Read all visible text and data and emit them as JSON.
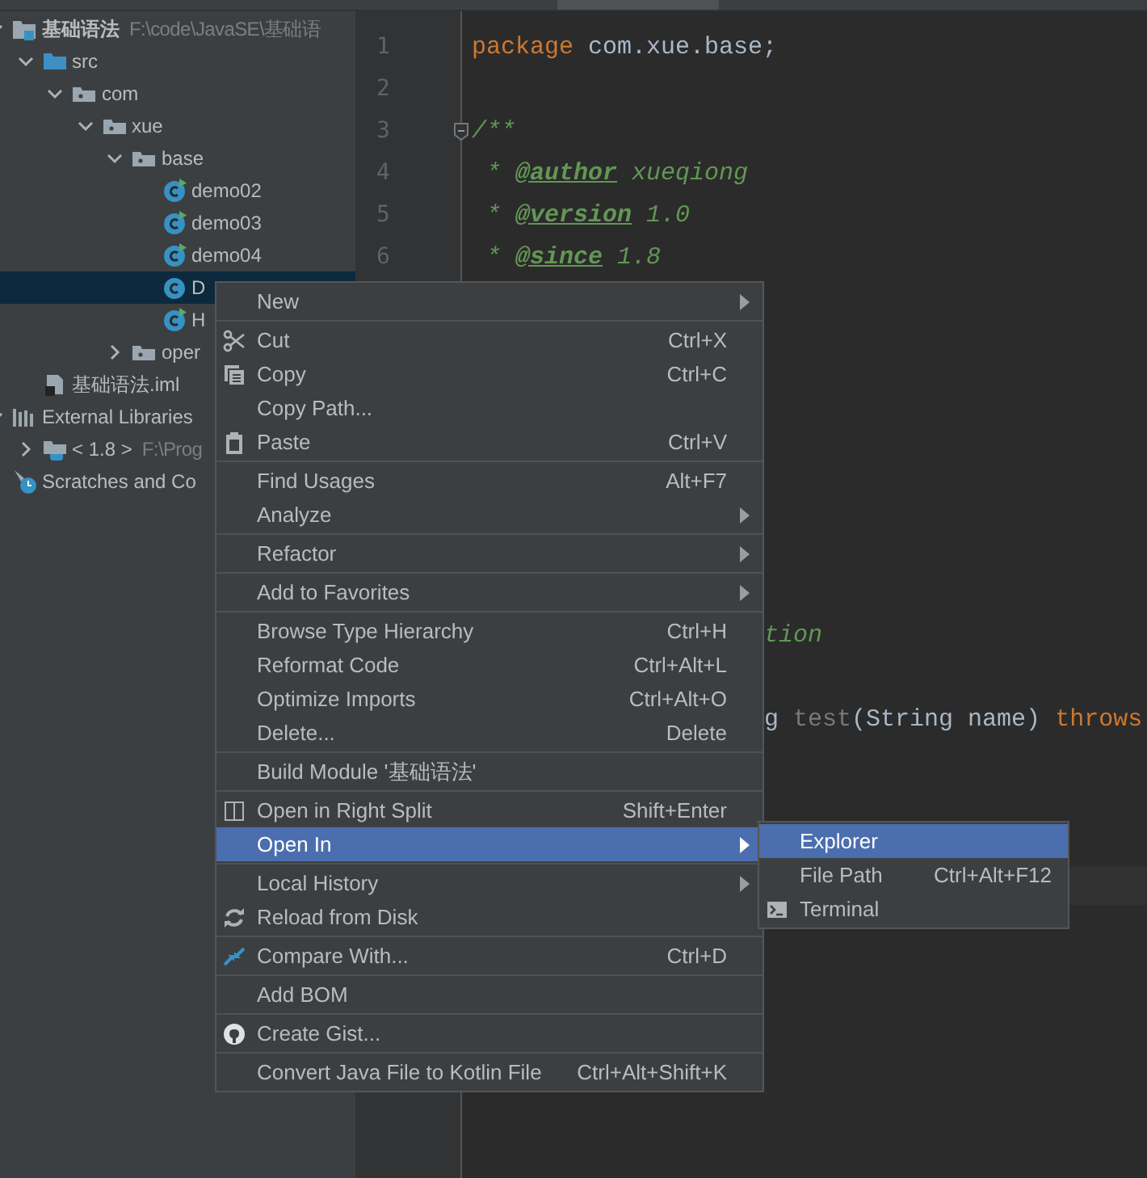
{
  "project_tree": [
    {
      "label": "基础语法",
      "path": "F:\\code\\JavaSE\\基础语",
      "kind": "module",
      "expanded": true,
      "selected": false,
      "children": [
        {
          "label": "src",
          "kind": "source-folder",
          "expanded": true,
          "selected": false,
          "children": [
            {
              "label": "com",
              "kind": "package",
              "expanded": true,
              "selected": false,
              "children": [
                {
                  "label": "xue",
                  "kind": "package",
                  "expanded": true,
                  "selected": false,
                  "children": [
                    {
                      "label": "base",
                      "kind": "package",
                      "expanded": true,
                      "selected": false,
                      "children": [
                        {
                          "label": "demo02",
                          "kind": "class",
                          "runnable": true,
                          "selected": false
                        },
                        {
                          "label": "demo03",
                          "kind": "class",
                          "runnable": true,
                          "selected": false
                        },
                        {
                          "label": "demo04",
                          "kind": "class",
                          "runnable": true,
                          "selected": false
                        },
                        {
                          "label": "D",
                          "kind": "class",
                          "runnable": false,
                          "selected": true
                        },
                        {
                          "label": "H",
                          "kind": "class",
                          "runnable": true,
                          "selected": false
                        }
                      ]
                    },
                    {
                      "label": "oper",
                      "kind": "package",
                      "expanded": false,
                      "selected": false
                    }
                  ]
                }
              ]
            }
          ]
        },
        {
          "label": "基础语法.iml",
          "kind": "file",
          "selected": false
        }
      ]
    },
    {
      "label": "External Libraries",
      "kind": "libraries",
      "expanded": true,
      "selected": false,
      "children": [
        {
          "label": "< 1.8 >",
          "path": "F:\\Prog",
          "kind": "sdk",
          "expanded": false,
          "selected": false
        }
      ]
    },
    {
      "label": "Scratches and Co",
      "kind": "scratches",
      "selected": false
    }
  ],
  "editor": {
    "lines": [
      {
        "number": "1",
        "segments": [
          {
            "text": "package ",
            "kind": "keyword"
          },
          {
            "text": "com.xue.base;",
            "kind": "plain"
          }
        ]
      },
      {
        "number": "2"
      },
      {
        "number": "3",
        "foldable": true,
        "segments": [
          {
            "text": "/**",
            "kind": "doc"
          }
        ]
      },
      {
        "number": "4",
        "segments": [
          {
            "text": " * ",
            "kind": "doc"
          },
          {
            "text": "@author",
            "kind": "doctag"
          },
          {
            "text": " xueqiong",
            "kind": "doc"
          }
        ]
      },
      {
        "number": "5",
        "segments": [
          {
            "text": " * ",
            "kind": "doc"
          },
          {
            "text": "@version",
            "kind": "doctag"
          },
          {
            "text": " 1.0",
            "kind": "doc"
          }
        ]
      },
      {
        "number": "6",
        "segments": [
          {
            "text": " * ",
            "kind": "doc"
          },
          {
            "text": "@since",
            "kind": "doctag"
          },
          {
            "text": " 1.8",
            "kind": "doc"
          }
        ]
      }
    ],
    "covered_lines": [
      {
        "segments": [
          {
            "text": "tion",
            "kind": "doc"
          }
        ]
      },
      {
        "segments": [
          {
            "text": "g ",
            "kind": "plain"
          },
          {
            "text": "test",
            "kind": "unused"
          },
          {
            "text": "(String name) ",
            "kind": "plain"
          },
          {
            "text": "throws",
            "kind": "keyword"
          }
        ]
      }
    ]
  },
  "context_menu": {
    "groups": [
      [
        {
          "label": "New",
          "submenu": true,
          "selected": false
        }
      ],
      [
        {
          "label": "Cut",
          "shortcut": "Ctrl+X",
          "submenu": false,
          "selected": false
        },
        {
          "label": "Copy",
          "shortcut": "Ctrl+C",
          "submenu": false,
          "selected": false
        },
        {
          "label": "Copy Path...",
          "submenu": false,
          "selected": false
        },
        {
          "label": "Paste",
          "shortcut": "Ctrl+V",
          "submenu": false,
          "selected": false
        }
      ],
      [
        {
          "label": "Find Usages",
          "shortcut": "Alt+F7",
          "submenu": false,
          "selected": false
        },
        {
          "label": "Analyze",
          "submenu": true,
          "selected": false
        }
      ],
      [
        {
          "label": "Refactor",
          "submenu": true,
          "selected": false
        }
      ],
      [
        {
          "label": "Add to Favorites",
          "submenu": true,
          "selected": false
        }
      ],
      [
        {
          "label": "Browse Type Hierarchy",
          "shortcut": "Ctrl+H",
          "submenu": false,
          "selected": false
        },
        {
          "label": "Reformat Code",
          "shortcut": "Ctrl+Alt+L",
          "submenu": false,
          "selected": false
        },
        {
          "label": "Optimize Imports",
          "shortcut": "Ctrl+Alt+O",
          "submenu": false,
          "selected": false
        },
        {
          "label": "Delete...",
          "shortcut": "Delete",
          "submenu": false,
          "selected": false
        }
      ],
      [
        {
          "label": "Build Module '基础语法'",
          "submenu": false,
          "selected": false
        }
      ],
      [
        {
          "label": "Open in Right Split",
          "shortcut": "Shift+Enter",
          "submenu": false,
          "selected": false
        },
        {
          "label": "Open In",
          "submenu": true,
          "selected": true
        }
      ],
      [
        {
          "label": "Local History",
          "submenu": true,
          "selected": false
        },
        {
          "label": "Reload from Disk",
          "submenu": false,
          "selected": false
        }
      ],
      [
        {
          "label": "Compare With...",
          "shortcut": "Ctrl+D",
          "submenu": false,
          "selected": false
        }
      ],
      [
        {
          "label": "Add BOM",
          "submenu": false,
          "selected": false
        }
      ],
      [
        {
          "label": "Create Gist...",
          "submenu": false,
          "selected": false
        }
      ],
      [
        {
          "label": "Convert Java File to Kotlin File",
          "shortcut": "Ctrl+Alt+Shift+K",
          "submenu": false,
          "selected": false
        }
      ]
    ]
  },
  "submenu": {
    "items": [
      {
        "label": "Explorer",
        "selected": true
      },
      {
        "label": "File Path",
        "shortcut": "Ctrl+Alt+F12",
        "selected": false
      },
      {
        "label": "Terminal",
        "selected": false
      }
    ]
  }
}
